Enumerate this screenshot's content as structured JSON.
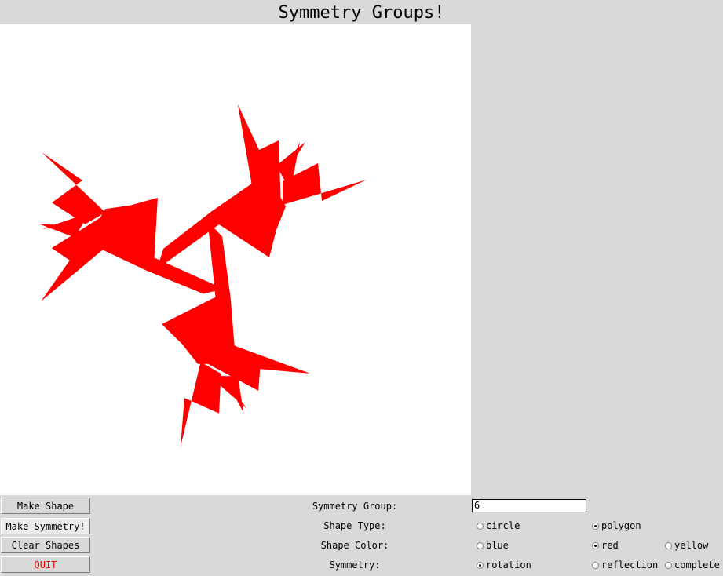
{
  "window": {
    "title": "Symmetry Groups!"
  },
  "canvas": {
    "shape_color": "#ff0000",
    "background": "#ffffff"
  },
  "buttons": {
    "make_shape": "Make Shape",
    "make_symmetry": "Make Symmetry!",
    "clear_shapes": "Clear Shapes",
    "quit": "QUIT"
  },
  "labels": {
    "symmetry_group": "Symmetry Group:",
    "shape_type": "Shape Type:",
    "shape_color": "Shape Color:",
    "symmetry": "Symmetry:"
  },
  "symmetry_group_value": "6",
  "options": {
    "shape_type": {
      "circle": "circle",
      "polygon": "polygon",
      "selected": "polygon"
    },
    "shape_color": {
      "blue": "blue",
      "red": "red",
      "yellow": "yellow",
      "selected": "red"
    },
    "symmetry": {
      "rotation": "rotation",
      "reflection": "reflection",
      "complete": "complete",
      "selected": "rotation"
    }
  }
}
